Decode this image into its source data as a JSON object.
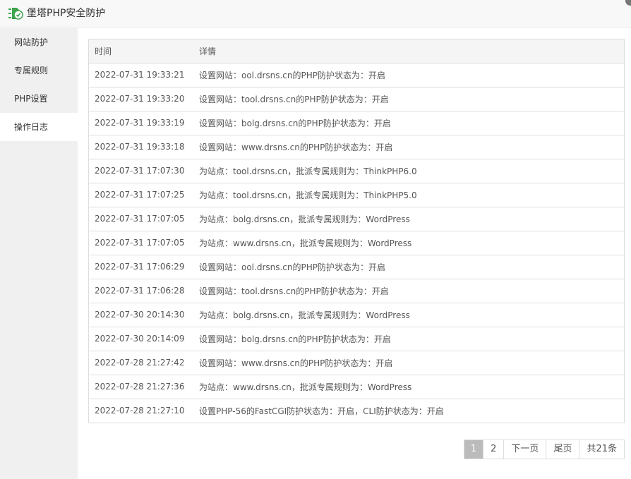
{
  "app": {
    "title": "堡塔PHP安全防护"
  },
  "sidebar": {
    "items": [
      {
        "label": "网站防护"
      },
      {
        "label": "专属规则"
      },
      {
        "label": "PHP设置"
      },
      {
        "label": "操作日志"
      }
    ],
    "active_index": 3
  },
  "table": {
    "headers": [
      "时间",
      "详情"
    ],
    "rows": [
      {
        "time": "2022-07-31 19:33:21",
        "detail": "设置网站：ool.drsns.cn的PHP防护状态为：开启"
      },
      {
        "time": "2022-07-31 19:33:20",
        "detail": "设置网站：tool.drsns.cn的PHP防护状态为：开启"
      },
      {
        "time": "2022-07-31 19:33:19",
        "detail": "设置网站：bolg.drsns.cn的PHP防护状态为：开启"
      },
      {
        "time": "2022-07-31 19:33:18",
        "detail": "设置网站：www.drsns.cn的PHP防护状态为：开启"
      },
      {
        "time": "2022-07-31 17:07:30",
        "detail": "为站点：tool.drsns.cn，批派专属规则为：ThinkPHP6.0"
      },
      {
        "time": "2022-07-31 17:07:25",
        "detail": "为站点：tool.drsns.cn，批派专属规则为：ThinkPHP5.0"
      },
      {
        "time": "2022-07-31 17:07:05",
        "detail": "为站点：bolg.drsns.cn，批派专属规则为：WordPress"
      },
      {
        "time": "2022-07-31 17:07:05",
        "detail": "为站点：www.drsns.cn，批派专属规则为：WordPress"
      },
      {
        "time": "2022-07-31 17:06:29",
        "detail": "设置网站：ool.drsns.cn的PHP防护状态为：开启"
      },
      {
        "time": "2022-07-31 17:06:28",
        "detail": "设置网站：tool.drsns.cn的PHP防护状态为：开启"
      },
      {
        "time": "2022-07-30 20:14:30",
        "detail": "为站点：bolg.drsns.cn，批派专属规则为：WordPress"
      },
      {
        "time": "2022-07-30 20:14:09",
        "detail": "设置网站：bolg.drsns.cn的PHP防护状态为：开启"
      },
      {
        "time": "2022-07-28 21:27:42",
        "detail": "设置网站：www.drsns.cn的PHP防护状态为：开启"
      },
      {
        "time": "2022-07-28 21:27:36",
        "detail": "为站点：www.drsns.cn，批派专属规则为：WordPress"
      },
      {
        "time": "2022-07-28 21:27:10",
        "detail": "设置PHP-56的FastCGI防护状态为：开启，CLI防护状态为：开启"
      }
    ]
  },
  "pagination": {
    "current": "1",
    "page2": "2",
    "next": "下一页",
    "last": "尾页",
    "total": "共21条"
  },
  "colors": {
    "logo_green": "#3fa34d",
    "current_page_bg": "#bbbbbb",
    "sidebar_bg": "#f0f0f0"
  },
  "icons": {
    "logo": "bt-logo-icon"
  }
}
